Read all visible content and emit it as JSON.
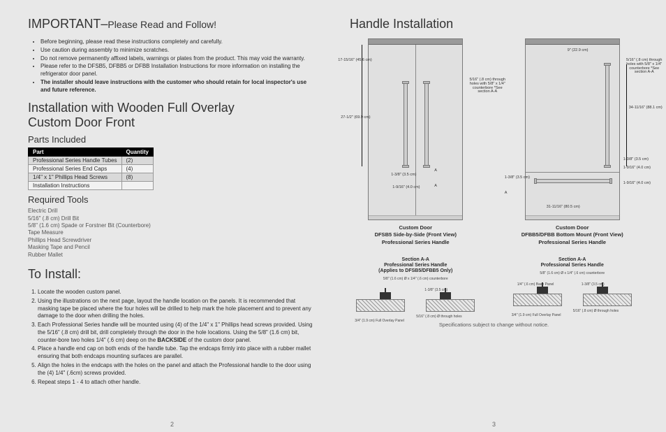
{
  "left": {
    "important_heading": "IMPORTANT–",
    "important_sub": "Please Read and Follow!",
    "bullets": [
      "Before beginning, please read these instructions completely and carefully.",
      "Use caution during assembly to minimize scratches.",
      "Do not remove permanently affixed labels, warnings or plates from the product. This may void the warranty.",
      "Please refer to the DFSB5, DFBB5 or DFBB Installation Instructions for more information on installing the refrigerator door panel.",
      "The installer should leave instructions with the customer who should retain for local inspector's use and future reference."
    ],
    "install_heading_1": "Installation with Wooden Full Overlay",
    "install_heading_2": "Custom Door Front",
    "parts_heading": "Parts Included",
    "parts_table": {
      "headers": [
        "Part",
        "Quantity"
      ],
      "rows": [
        [
          "Professional Series Handle Tubes",
          "(2)"
        ],
        [
          "Professional Series End Caps",
          "(4)"
        ],
        [
          "1/4\" x 1\" Phillips Head Screws",
          "(8)"
        ],
        [
          "Installation Instructions",
          ""
        ]
      ]
    },
    "tools_heading": "Required Tools",
    "tools": [
      "Electric Drill",
      "5/16\" (.8 cm) Drill Bit",
      "5/8\" (1.6 cm) Spade or Forstner Bit (Counterbore)",
      "Tape Measure",
      "Phillips Head Screwdriver",
      "Masking Tape and Pencil",
      "Rubber Mallet"
    ],
    "to_install_heading": "To Install:",
    "steps": [
      "Locate the wooden custom panel.",
      "Using the illustrations on the next page, layout the handle location on the panels. It is recommended that masking tape be placed where the four holes will be drilled to help mark the hole placement and to prevent any damage to the door when drilling the holes.",
      "Each Professional Series handle will be mounted using (4) of the 1/4\" x 1\" Phillips head screws provided. Using the 5/16\" (.8 cm) drill bit, drill completely through the door in the hole locations. Using the 5/8\" (1.6 cm) bit, counter-bore two holes 1/4\" (.6 cm) deep on the BACKSIDE of the custom door panel.",
      "Place a handle end cap on both ends of the handle tube. Tap the endcaps firmly into place with a rubber mallet ensuring that both endcaps mounting surfaces are parallel.",
      "Align the holes in the endcaps with the holes on the panel and attach the Professional handle to the door using the (4) 1/4\" (.6cm) screws provided.",
      "Repeat steps 1 - 4 to attach other handle."
    ],
    "page_number": "2"
  },
  "right": {
    "heading": "Handle Installation",
    "diag1": {
      "title1": "Custom Door",
      "title2": "DFSB5 Side-by-Side (Front View)",
      "title3": "Professional Series Handle",
      "dims": {
        "top_offset": "17-15/16\"\n(45.6 cm)",
        "handle_len": "27-1/2\"\n(69.9 cm)",
        "bottom_gap": "1-3/8\"\n(3.5 cm)",
        "side_gap": "1-9/16\"\n(4.0 cm)",
        "note": "5/16\" (.8 cm)\nthrough holes\nwith 5/8\" x 1/4\"\ncounterbore\n*See section A-A",
        "A": "A"
      }
    },
    "diag2": {
      "title1": "Custom Door",
      "title2": "DFBB5/DFBB Bottom Mount (Front View)",
      "title3": "Professional Series Handle",
      "dims": {
        "top_offset": "9\"\n(22.9 cm)",
        "handle_len": "34-11/16\"\n(88.1 cm)",
        "side_gap_top": "1-3/8\" (3.5 cm)",
        "side_gap_bot": "1-9/16\" (4.0 cm)",
        "lower_width": "31-11/16\" (80.5 cm)",
        "lower_side": "1-3/8\"\n(3.5 cm)",
        "lower_side2": "1-9/16\" (4.0 cm)",
        "note": "5/16\" (.8 cm)\nthrough holes\nwith 5/8\" x 1/4\"\ncounterbore\n*See section A-A",
        "A": "A"
      }
    },
    "sectionA": {
      "title1": "Section A-A",
      "title2": "Professional Series Handle",
      "scope1": "(Applies to DFSB5/DFBB5 Only)",
      "dims_top": "5/8\" (1.6 cm) Ø x 1/4\" (.6 cm) counterbore",
      "block_w": "1-3/8\" (3.5 cm)",
      "through": "5/16\" (.8 cm) Ø through holes",
      "panel": "3/4\" (1.9 cm)\nFull Overlay Panel",
      "gap": "1/4\" (.6 cm)\nBase Panel"
    },
    "sectionB": {
      "title1": "Section A-A",
      "title2": "Professional Series Handle",
      "dims_top": "5/8\" (1.6 cm) Ø x 1/4\" (.6 cm) counterbore",
      "block_w": "1-3/8\" (3.5 cm)",
      "through": "5/16\" (.8 cm) Ø through holes",
      "panel": "3/4\" (1.9 cm)\nFull Overlay Panel",
      "gap": "1/4\" (.6 cm)\nBase Panel"
    },
    "spec_note": "Specifications subject to change without notice.",
    "page_number": "3"
  }
}
